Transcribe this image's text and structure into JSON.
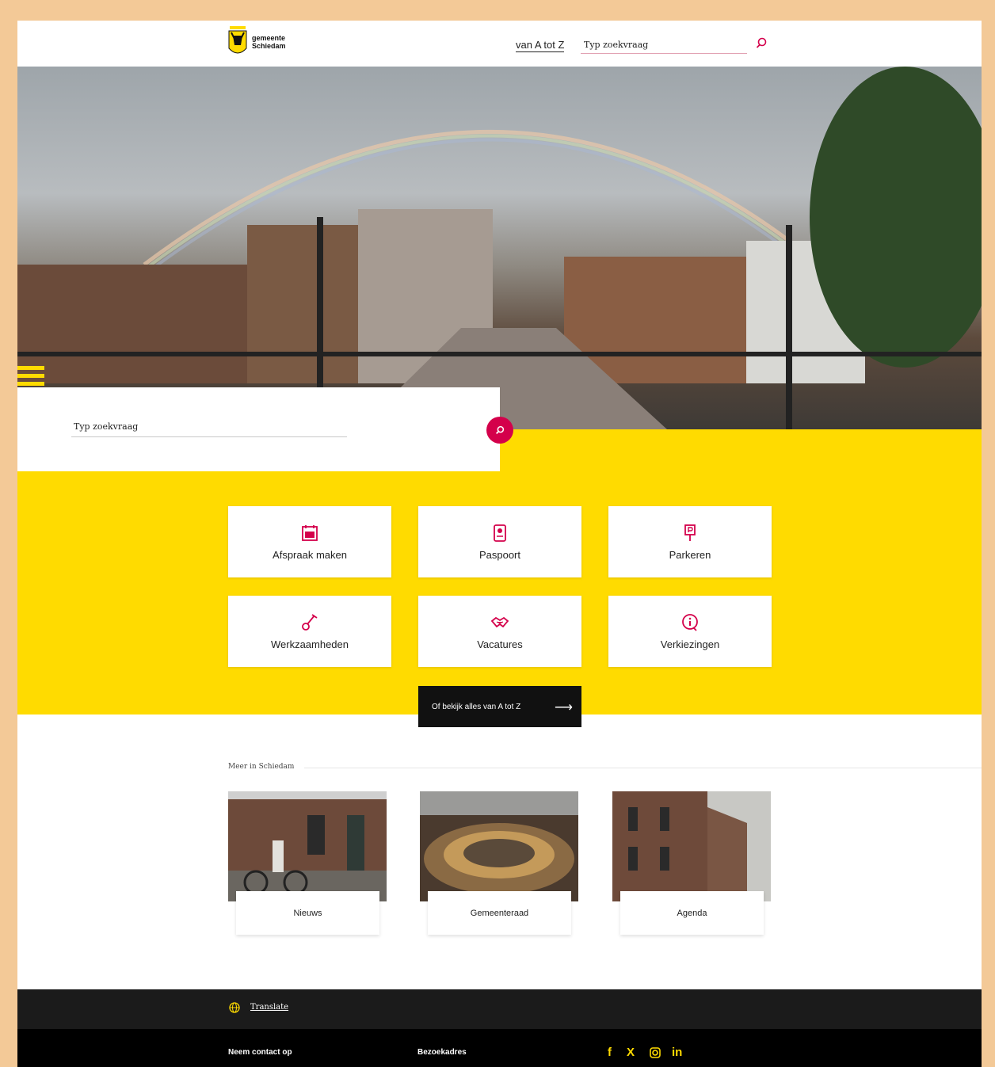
{
  "header": {
    "logo_line1": "gemeente",
    "logo_line2": "Schiedam",
    "nav_az": "van A tot Z",
    "search_placeholder": "Typ zoekvraag"
  },
  "hero": {
    "search_placeholder": "Typ zoekvraag"
  },
  "tiles": [
    {
      "label": "Afspraak maken",
      "icon": "calendar-icon"
    },
    {
      "label": "Paspoort",
      "icon": "passport-icon"
    },
    {
      "label": "Parkeren",
      "icon": "parking-sign-icon"
    },
    {
      "label": "Werkzaamheden",
      "icon": "shovel-icon"
    },
    {
      "label": "Vacatures",
      "icon": "handshake-icon"
    },
    {
      "label": "Verkiezingen",
      "icon": "info-icon"
    }
  ],
  "all_button": "Of bekijk alles van A tot Z",
  "meer": {
    "title": "Meer in Schiedam",
    "cards": [
      {
        "label": "Nieuws"
      },
      {
        "label": "Gemeenteraad"
      },
      {
        "label": "Agenda"
      }
    ]
  },
  "footer": {
    "translate": "Translate",
    "contact_heading": "Neem contact op",
    "address_heading": "Bezoekadres",
    "social": [
      "f",
      "X",
      "instagram-icon",
      "in"
    ]
  },
  "colors": {
    "accent": "#d4004b",
    "yellow": "#ffdb00",
    "dark": "#1b1b1b"
  }
}
